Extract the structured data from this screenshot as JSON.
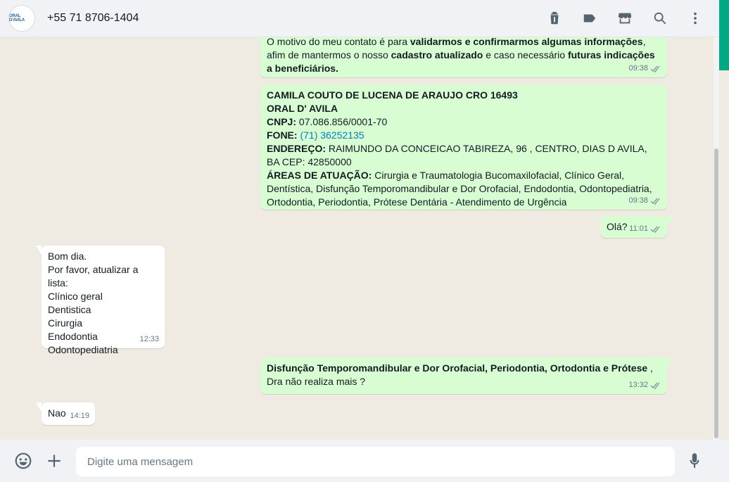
{
  "header": {
    "avatar_text": "ORAL D'AVILA",
    "contact": "+55 71 8706-1404"
  },
  "messages": [
    {
      "time": "09:38"
    },
    {
      "time": "09:38"
    },
    {
      "text": "Olá?",
      "time": "11:01"
    },
    {
      "lines": [
        "Bom dia.",
        "Por favor, atualizar a lista:",
        "Clínico geral",
        "Dentistica",
        "Cirurgia",
        "Endodontia",
        "Odontopediatria"
      ],
      "time": "12:33"
    },
    {
      "time": "13:32"
    },
    {
      "text": "Nao",
      "time": "14:19"
    }
  ],
  "m0": {
    "p1": "O motivo do meu contato é para ",
    "b1": "validarmos e confirmarmos algumas informações",
    "p2": ", afim de mantermos o nosso ",
    "b2": "cadastro atualizado",
    "p3": " e caso necessário ",
    "b3": "futuras indicações a beneficiários."
  },
  "m1": {
    "name": "CAMILA COUTO DE LUCENA DE ARAUJO CRO 16493",
    "clinic": "ORAL D' AVILA",
    "cnpj_label": "CNPJ:",
    "cnpj": " 07.086.856/0001-70",
    "fone_label": "FONE:",
    "fone": "(71) 36252135",
    "endereco_label": "ENDEREÇO:",
    "endereco": " RAIMUNDO DA CONCEICAO TABIREZA, 96 , CENTRO, DIAS D AVILA, BA CEP: 42850000",
    "areas_label": "ÁREAS DE ATUAÇÃO:",
    "areas": " Cirurgia e Traumatologia Bucomaxilofacial, Clínico Geral, Dentística, Disfunção Temporomandibular e Dor Orofacial, Endodontia, Odontopediatria, Ortodontia, Periodontia, Prótese Dentária - Atendimento de Urgência"
  },
  "m4": {
    "bold": "Disfunção Temporomandibular e Dor Orofacial, Periodontia, Ortodontia e Prótese",
    "rest": " , Dra não realiza mais ?"
  },
  "composer": {
    "placeholder": "Digite uma mensagem"
  },
  "icons": [
    "delete-icon",
    "label-icon",
    "store-icon",
    "search-icon",
    "menu-icon",
    "emoji-icon",
    "plus-icon",
    "mic-icon",
    "double-check-icon"
  ],
  "colors": {
    "outgoing": "#d9fdd3",
    "incoming": "#ffffff",
    "accent": "#00a884",
    "link": "#027eb5"
  }
}
